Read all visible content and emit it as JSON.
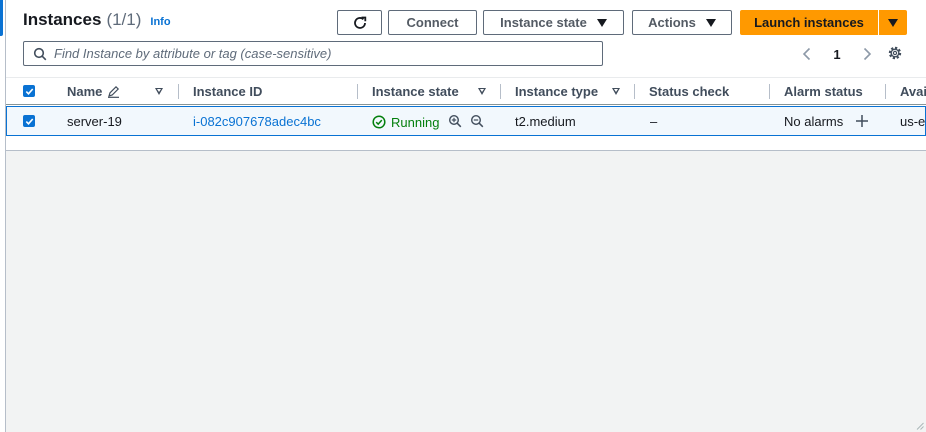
{
  "header": {
    "title": "Instances",
    "count": "(1/1)",
    "info": "Info"
  },
  "toolbar": {
    "connect": "Connect",
    "instance_state": "Instance state",
    "actions": "Actions",
    "launch": "Launch instances"
  },
  "search": {
    "placeholder": "Find Instance by attribute or tag (case-sensitive)"
  },
  "pagination": {
    "page": "1"
  },
  "table": {
    "columns": [
      "Name",
      "Instance ID",
      "Instance state",
      "Instance type",
      "Status check",
      "Alarm status",
      "Avai"
    ],
    "rows": [
      {
        "name": "server-19",
        "instance_id": "i-082c907678adec4bc",
        "state": "Running",
        "type": "t2.medium",
        "status_check": "–",
        "alarm_status": "No alarms",
        "availability_zone": "us-e"
      }
    ]
  },
  "colors": {
    "accent": "#0972d3",
    "primary_button": "#ff9900",
    "running": "#037f0c"
  }
}
